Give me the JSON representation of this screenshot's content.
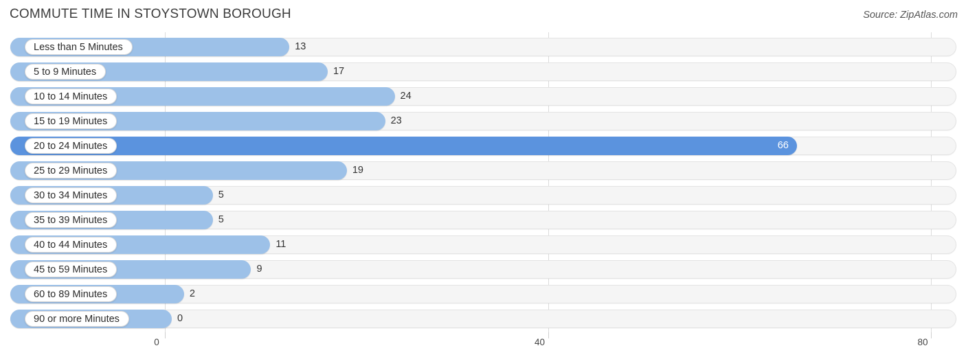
{
  "header": {
    "title": "COMMUTE TIME IN STOYSTOWN BOROUGH",
    "source": "Source: ZipAtlas.com"
  },
  "colors": {
    "bar": "#9dc1e8",
    "bar_highlight": "#5b93de",
    "track": "#f5f5f5",
    "gridline": "#dcdcdc",
    "text": "#333333"
  },
  "chart_data": {
    "type": "bar",
    "orientation": "horizontal",
    "title": "COMMUTE TIME IN STOYSTOWN BOROUGH",
    "xlabel": "",
    "ylabel": "",
    "xlim": [
      0,
      80
    ],
    "xticks": [
      0,
      40,
      80
    ],
    "xtick_labels": [
      "0",
      "40",
      "80"
    ],
    "grid": true,
    "legend": false,
    "highlight_category": "20 to 24 Minutes",
    "categories": [
      "Less than 5 Minutes",
      "5 to 9 Minutes",
      "10 to 14 Minutes",
      "15 to 19 Minutes",
      "20 to 24 Minutes",
      "25 to 29 Minutes",
      "30 to 34 Minutes",
      "35 to 39 Minutes",
      "40 to 44 Minutes",
      "45 to 59 Minutes",
      "60 to 89 Minutes",
      "90 or more Minutes"
    ],
    "values": [
      13,
      17,
      24,
      23,
      66,
      19,
      5,
      5,
      11,
      9,
      2,
      0
    ],
    "value_labels": [
      "13",
      "17",
      "24",
      "23",
      "66",
      "19",
      "5",
      "5",
      "11",
      "9",
      "2",
      "0"
    ]
  }
}
